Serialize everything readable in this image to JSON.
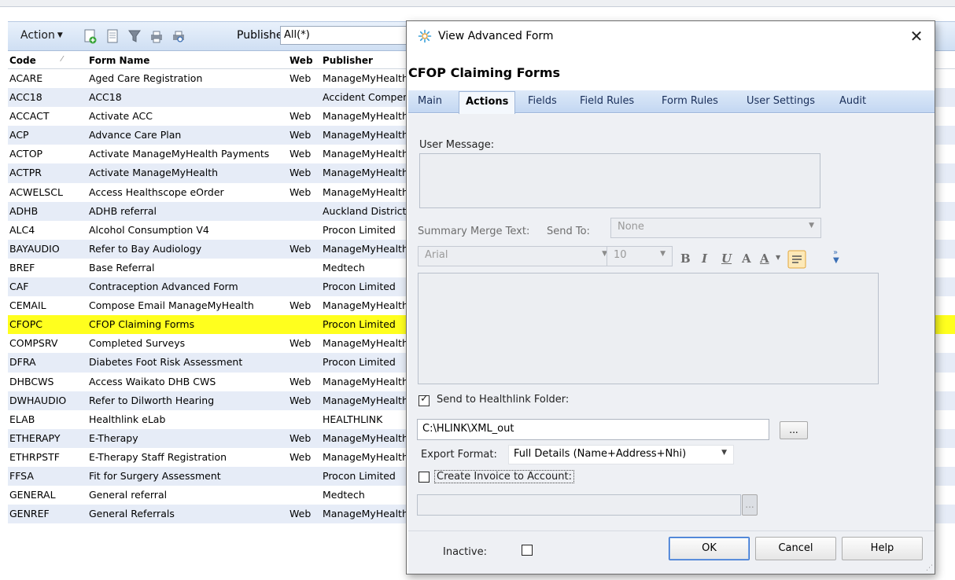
{
  "toolbar": {
    "action_label": "Action",
    "publisher_label": "Publisher:",
    "publisher_value": "All(*)",
    "icons": [
      "add-form-icon",
      "form-document-icon",
      "filter-icon",
      "print-icon",
      "print-preview-icon"
    ]
  },
  "grid": {
    "headers": {
      "code": "Code",
      "name": "Form Name",
      "web": "Web",
      "publisher": "Publisher"
    },
    "rows": [
      {
        "code": "ACARE",
        "name": "Aged Care Registration",
        "web": "Web",
        "publisher": "ManageMyHealth"
      },
      {
        "code": "ACC18",
        "name": "ACC18",
        "web": "",
        "publisher": "Accident Compensation"
      },
      {
        "code": "ACCACT",
        "name": "Activate ACC",
        "web": "Web",
        "publisher": "ManageMyHealth"
      },
      {
        "code": "ACP",
        "name": "Advance Care Plan",
        "web": "Web",
        "publisher": "ManageMyHealth"
      },
      {
        "code": "ACTOP",
        "name": "Activate ManageMyHealth Payments",
        "web": "Web",
        "publisher": "ManageMyHealth"
      },
      {
        "code": "ACTPR",
        "name": "Activate ManageMyHealth",
        "web": "Web",
        "publisher": "ManageMyHealth"
      },
      {
        "code": "ACWELSCL",
        "name": "Access Healthscope eOrder",
        "web": "Web",
        "publisher": "ManageMyHealth"
      },
      {
        "code": "ADHB",
        "name": "ADHB referral",
        "web": "",
        "publisher": "Auckland District"
      },
      {
        "code": "ALC4",
        "name": "Alcohol Consumption V4",
        "web": "",
        "publisher": "Procon Limited"
      },
      {
        "code": "BAYAUDIO",
        "name": "Refer to Bay Audiology",
        "web": "Web",
        "publisher": "ManageMyHealth"
      },
      {
        "code": "BREF",
        "name": "Base Referral",
        "web": "",
        "publisher": "Medtech"
      },
      {
        "code": "CAF",
        "name": "Contraception Advanced Form",
        "web": "",
        "publisher": "Procon Limited"
      },
      {
        "code": "CEMAIL",
        "name": "Compose Email ManageMyHealth",
        "web": "Web",
        "publisher": "ManageMyHealth"
      },
      {
        "code": "CFOPC",
        "name": "CFOP Claiming Forms",
        "web": "",
        "publisher": "Procon Limited"
      },
      {
        "code": "COMPSRV",
        "name": "Completed Surveys",
        "web": "Web",
        "publisher": "ManageMyHealth"
      },
      {
        "code": "DFRA",
        "name": "Diabetes Foot Risk Assessment",
        "web": "",
        "publisher": "Procon Limited"
      },
      {
        "code": "DHBCWS",
        "name": "Access Waikato DHB CWS",
        "web": "Web",
        "publisher": "ManageMyHealth"
      },
      {
        "code": "DWHAUDIO",
        "name": "Refer to Dilworth Hearing",
        "web": "Web",
        "publisher": "ManageMyHealth"
      },
      {
        "code": "ELAB",
        "name": "Healthlink eLab",
        "web": "",
        "publisher": "HEALTHLINK"
      },
      {
        "code": "ETHERAPY",
        "name": "E-Therapy",
        "web": "Web",
        "publisher": "ManageMyHealth"
      },
      {
        "code": "ETHRPSTF",
        "name": "E-Therapy Staff Registration",
        "web": "Web",
        "publisher": "ManageMyHealth"
      },
      {
        "code": "FFSA",
        "name": "Fit for Surgery Assessment",
        "web": "",
        "publisher": "Procon Limited"
      },
      {
        "code": "GENERAL",
        "name": "General referral",
        "web": "",
        "publisher": "Medtech"
      },
      {
        "code": "GENREF",
        "name": "General Referrals",
        "web": "Web",
        "publisher": "ManageMyHealth"
      }
    ],
    "selected_code": "CFOPC"
  },
  "dialog": {
    "title": "View Advanced Form",
    "close_label": "✕",
    "form_heading": "CFOP Claiming Forms",
    "tabs": [
      {
        "label": "Main",
        "active": false
      },
      {
        "label": "Actions",
        "active": true
      },
      {
        "label": "Fields",
        "active": false
      },
      {
        "label": "Field Rules",
        "active": false
      },
      {
        "label": "Form Rules",
        "active": false
      },
      {
        "label": "User Settings",
        "active": false
      },
      {
        "label": "Audit",
        "active": false
      }
    ],
    "actions": {
      "user_message_label": "User Message:",
      "summary_merge_label": "Summary Merge Text:",
      "send_to_label": "Send To:",
      "send_to_value": "None",
      "font_name": "Arial",
      "font_size": "10",
      "format_buttons": [
        "B",
        "I",
        "U",
        "A",
        "A"
      ],
      "send_healthlink_label": "Send to Healthlink Folder:",
      "send_healthlink_checked": true,
      "healthlink_path": "C:\\HLINK\\XML_out",
      "browse_label": "...",
      "export_format_label": "Export Format:",
      "export_format_value": "Full Details (Name+Address+Nhi)",
      "create_invoice_label": "Create Invoice to Account:",
      "create_invoice_checked": false,
      "account_browse_label": "..."
    },
    "footer": {
      "inactive_label": "Inactive:",
      "inactive_checked": false,
      "ok_label": "OK",
      "cancel_label": "Cancel",
      "help_label": "Help"
    }
  },
  "colors": {
    "selected_row": "#ffff1e",
    "alt_row": "#e6ecf7",
    "accent": "#2f6ecf"
  }
}
